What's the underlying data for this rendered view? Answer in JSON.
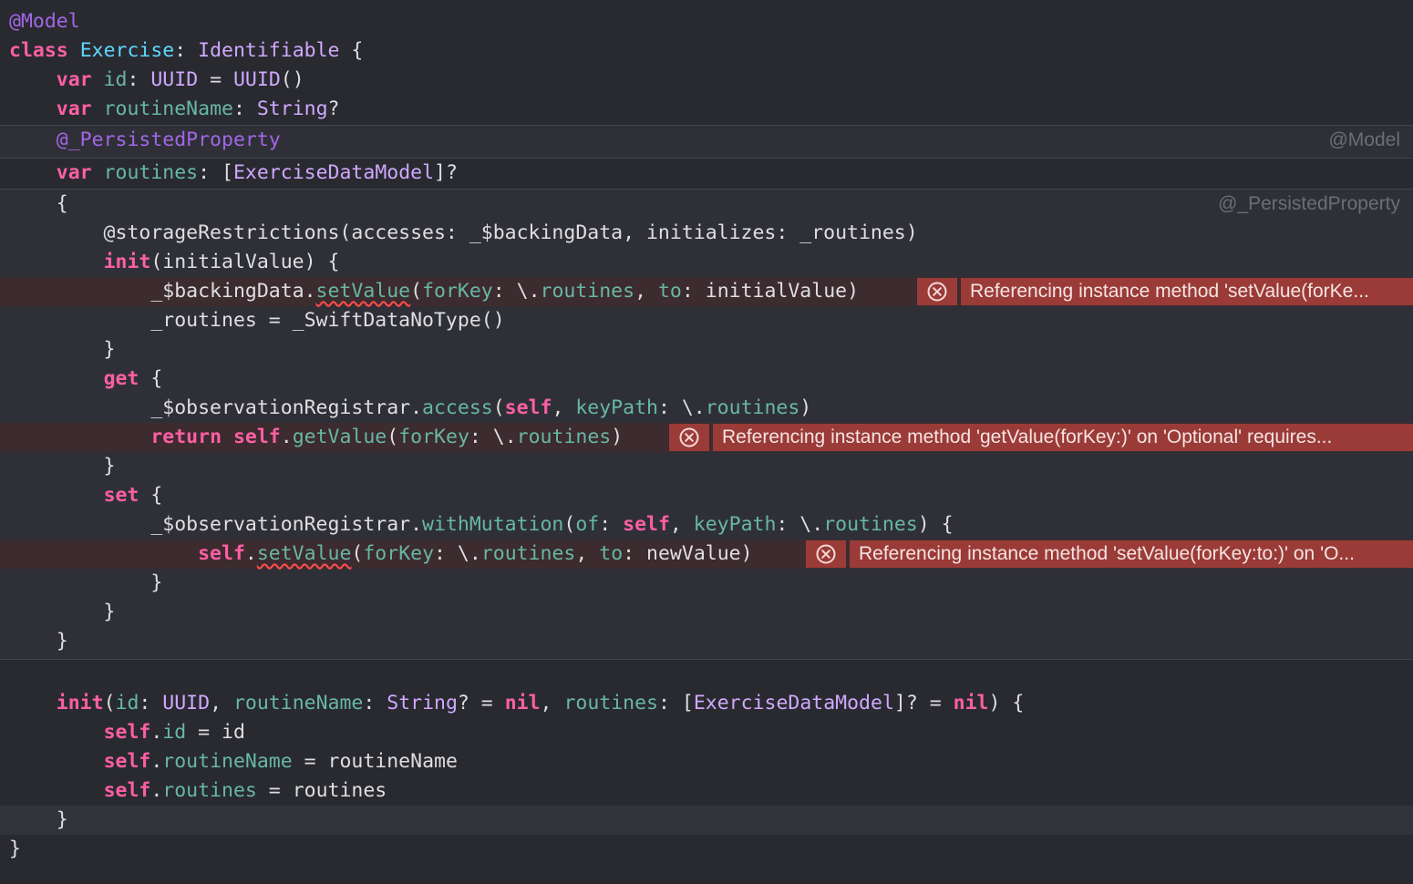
{
  "editor": {
    "theme": {
      "background": "#292a30",
      "keyword": "#fc5fa3",
      "type": "#d0a8ff",
      "class_decl": "#5dd8ff",
      "property": "#67b7a4",
      "attribute": "#a167e6",
      "plain": "#dfdfe0",
      "error_banner": "#9b3b37"
    },
    "macro_labels": {
      "model": "@Model",
      "persisted_property": "@_PersistedProperty"
    },
    "errors": [
      {
        "icon": "error-circle-x-icon",
        "message": "Referencing instance method 'setValue(forKe..."
      },
      {
        "icon": "error-circle-x-icon",
        "message": "Referencing instance method 'getValue(forKey:)' on 'Optional' requires..."
      },
      {
        "icon": "error-circle-x-icon",
        "message": "Referencing instance method 'setValue(forKey:to:)' on 'O..."
      }
    ]
  }
}
